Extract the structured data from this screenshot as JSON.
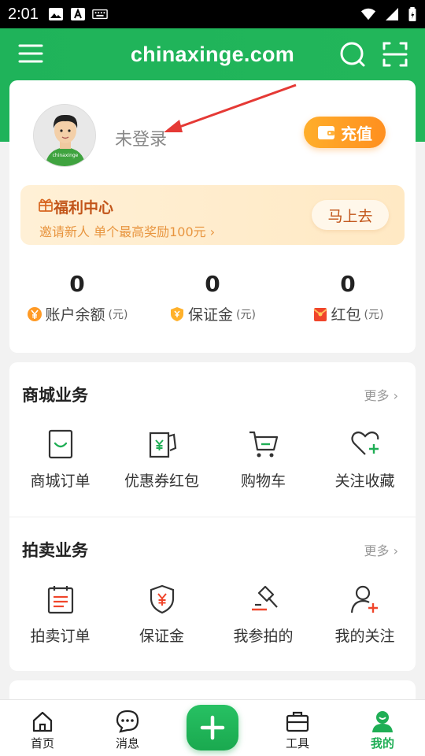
{
  "status_bar": {
    "time": "2:01",
    "icons": [
      "image-icon",
      "text-a-icon",
      "keyboard-icon"
    ],
    "right_icons": [
      "wifi-icon",
      "signal-icon",
      "battery-icon"
    ]
  },
  "header": {
    "title": "chinaxinge.com",
    "menu_icon": "menu-icon",
    "search_icon": "search-icon",
    "scan_icon": "scan-icon",
    "color": "#22b65a"
  },
  "profile": {
    "avatar_text": "chinaxinge",
    "login_text": "未登录",
    "recharge_label": "充值",
    "welfare": {
      "title": "福利中心",
      "subtitle": "邀请新人 单个最高奖励100元",
      "chevron": "›",
      "button": "马上去"
    },
    "stats": [
      {
        "value": "0",
        "label": "账户余额",
        "unit": "(元)",
        "icon": "yen-coin-icon"
      },
      {
        "value": "0",
        "label": "保证金",
        "unit": "(元)",
        "icon": "shield-icon"
      },
      {
        "value": "0",
        "label": "红包",
        "unit": "(元)",
        "icon": "red-envelope-icon"
      }
    ]
  },
  "sections": [
    {
      "title": "商城业务",
      "more": "更多 ›",
      "items": [
        {
          "label": "商城订单",
          "icon": "shopping-bag-icon"
        },
        {
          "label": "优惠券红包",
          "icon": "coupon-icon"
        },
        {
          "label": "购物车",
          "icon": "cart-icon"
        },
        {
          "label": "关注收藏",
          "icon": "heart-plus-icon"
        }
      ]
    },
    {
      "title": "拍卖业务",
      "more": "更多 ›",
      "items": [
        {
          "label": "拍卖订单",
          "icon": "clipboard-icon"
        },
        {
          "label": "保证金",
          "icon": "shield-yen-icon"
        },
        {
          "label": "我参拍的",
          "icon": "gavel-icon"
        },
        {
          "label": "我的关注",
          "icon": "user-plus-icon"
        }
      ]
    }
  ],
  "bottom_nav": [
    {
      "label": "首页",
      "icon": "home-icon"
    },
    {
      "label": "消息",
      "icon": "chat-icon"
    },
    {
      "label": "",
      "icon": "plus-icon"
    },
    {
      "label": "工具",
      "icon": "toolbox-icon"
    },
    {
      "label": "我的",
      "icon": "profile-icon",
      "active": true
    }
  ],
  "colors": {
    "accent": "#1fae55",
    "orange": "#ff9a25",
    "annotation": "#e53935"
  }
}
